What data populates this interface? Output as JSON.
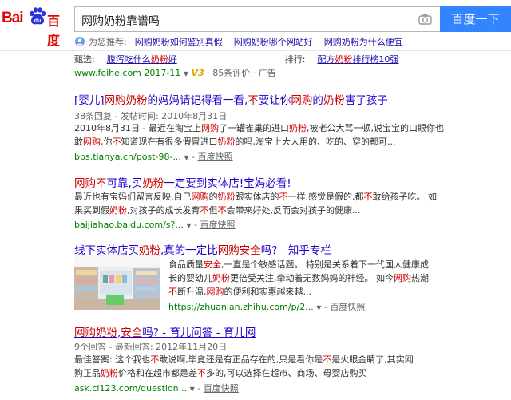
{
  "header": {
    "logo_bai": "Bai",
    "logo_du": "du",
    "logo_cn": "百度",
    "query": "网购奶粉靠谱吗",
    "search_button": "百度一下"
  },
  "recommend": {
    "label": "为您推荐:",
    "items": [
      "网购奶粉如何鉴别真假",
      "网购奶粉哪个网站好",
      "网购奶粉为什么便宜"
    ]
  },
  "ad": {
    "selected_label": "甄选:",
    "selected_link": "腹泻吃什么奶粉好",
    "rank_label": "排行:",
    "rank_link": "配方奶粉排行榜10强",
    "url": "www.feihe.com",
    "date": "2017-11",
    "badge": "V3",
    "reviews": "85条评价",
    "tag": "广告"
  },
  "results": [
    {
      "title": "[婴儿]网购奶粉的妈妈请记得看一看,不要让你网购的奶粉害了孩子",
      "meta": "38条回复 - 发帖时间: 2010年8月31日",
      "abstract_1": "2010年8月31日 - 最近在淘宝上网购了一罐雀巢的进口奶粉,被老公大骂一顿,说宝宝的口眼你也",
      "abstract_2": "敢网购,你不知道现在有很多假冒进口奶粉的吗,淘宝上大人用的、吃的、穿的都可...",
      "url": "bbs.tianya.cn/post-98-...",
      "snapshot": "百度快照"
    },
    {
      "title": "网购不可靠,买奶粉一定要到实体店!宝妈必看!",
      "abstract_1": "最近也有宝妈们留言反映,自己网购的奶粉跟实体店的不一样,感觉是假的,都不敢给孩子吃。 如",
      "abstract_2": "果买到假奶粉,对孩子的成长发育不但不会带来好处,反而会对孩子的健康...",
      "url": "baijiahao.baidu.com/s?...",
      "snapshot": "百度快照"
    },
    {
      "title": "线下实体店买奶粉,真的一定比网购安全吗? - 知乎专栏",
      "abstract_1": "食品质量安全,一直是个敏感话题。 特别是关系着下一代国人健康成",
      "abstract_2": "长的婴幼儿奶粉更倍受关注,牵动着无数妈妈的神经。 如今网购热潮",
      "abstract_3": "不断升温,网购的便利和实惠越来越...",
      "url": "https://zhuanlan.zhihu.com/p/2...",
      "snapshot": "百度快照"
    },
    {
      "title": "网购奶粉,安全吗? - 育儿问答 - 育儿网",
      "meta": "9个回答 - 最新回答: 2012年11月20日",
      "abstract_1": "最佳答案: 这个我也不敢说啊,毕竟还是有正品存在的,只是看你是不是火眼金睛了,其实网",
      "abstract_2": "购正品奶粉价格和在超市都是差不多的,可以选择在超市、商场、母婴店购买",
      "url": "ask.ci123.com/question...",
      "snapshot": "百度快照"
    }
  ],
  "colors": {
    "brand_red": "#e10601",
    "search_blue": "#3385ff",
    "link": "#2200cc",
    "url_green": "#008000",
    "highlight": "#cc0000"
  },
  "icons": [
    "baidu-paw-icon",
    "camera-icon",
    "recommend-icon",
    "dropdown-caret-icon"
  ]
}
